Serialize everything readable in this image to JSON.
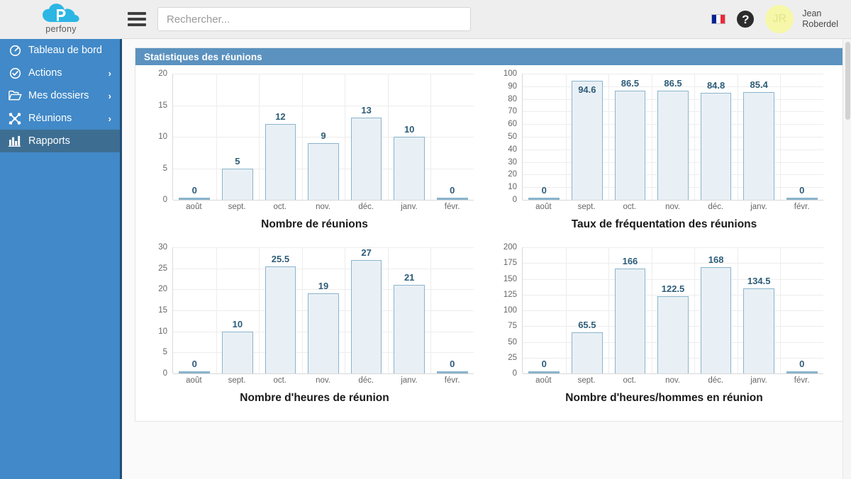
{
  "app": {
    "logo_text": "perfony",
    "logo_accent": "#2cb6e4"
  },
  "header": {
    "menu_icon": "hamburger-icon",
    "search": {
      "value": "",
      "placeholder": "Rechercher..."
    },
    "language_icon": "french-flag-icon",
    "help_icon": "help-question-icon",
    "user": {
      "initials": "JR",
      "first_name": "Jean",
      "last_name": "Roberdel"
    }
  },
  "sidebar": {
    "background": "#4189c8",
    "active_background": "#3d6e92",
    "items": [
      {
        "label": "Tableau de bord",
        "icon": "gauge-icon",
        "has_chevron": false,
        "active": false
      },
      {
        "label": "Actions",
        "icon": "check-circle-icon",
        "has_chevron": true,
        "active": false
      },
      {
        "label": "Mes dossiers",
        "icon": "folder-open-icon",
        "has_chevron": true,
        "active": false
      },
      {
        "label": "Réunions",
        "icon": "network-nodes-icon",
        "has_chevron": true,
        "active": false
      },
      {
        "label": "Rapports",
        "icon": "bar-chart-icon",
        "has_chevron": false,
        "active": true
      }
    ],
    "chevron_glyph": "›"
  },
  "panel": {
    "title": "Statistiques des réunions",
    "header_color": "#5b92bf"
  },
  "chart_data": [
    {
      "type": "bar",
      "title": "Nombre de réunions",
      "xlabel": "",
      "ylabel": "",
      "categories": [
        "août",
        "sept.",
        "oct.",
        "nov.",
        "déc.",
        "janv.",
        "févr."
      ],
      "values": [
        0,
        5,
        12,
        9,
        13,
        10,
        0
      ],
      "labels": [
        "0",
        "5",
        "12",
        "9",
        "13",
        "10",
        "0"
      ],
      "yticks": [
        0,
        5,
        10,
        15,
        20
      ],
      "ylim": [
        0,
        20
      ],
      "grid": true,
      "legend": "none",
      "bar_fill": "#e9f0f5",
      "bar_stroke": "#8ab4cd",
      "label_color": "#2e5c78"
    },
    {
      "type": "bar",
      "title": "Taux de fréquentation des réunions",
      "xlabel": "",
      "ylabel": "",
      "categories": [
        "août",
        "sept.",
        "oct.",
        "nov.",
        "déc.",
        "janv.",
        "févr."
      ],
      "values": [
        0,
        94.6,
        86.5,
        86.5,
        84.8,
        85.4,
        0
      ],
      "labels": [
        "0",
        "94.6",
        "86.5",
        "86.5",
        "84.8",
        "85.4",
        "0"
      ],
      "label_inside": [
        false,
        true,
        false,
        false,
        false,
        false,
        false
      ],
      "yticks": [
        0,
        10,
        20,
        30,
        40,
        50,
        60,
        70,
        80,
        90,
        100
      ],
      "ylim": [
        0,
        100
      ],
      "grid": true,
      "legend": "none",
      "bar_fill": "#e9f0f5",
      "bar_stroke": "#8ab4cd",
      "label_color": "#2e5c78"
    },
    {
      "type": "bar",
      "title": "Nombre d'heures de réunion",
      "xlabel": "",
      "ylabel": "",
      "categories": [
        "août",
        "sept.",
        "oct.",
        "nov.",
        "déc.",
        "janv.",
        "févr."
      ],
      "values": [
        0,
        10,
        25.5,
        19,
        27,
        21,
        0
      ],
      "labels": [
        "0",
        "10",
        "25.5",
        "19",
        "27",
        "21",
        "0"
      ],
      "yticks": [
        0,
        5,
        10,
        15,
        20,
        25,
        30
      ],
      "ylim": [
        0,
        30
      ],
      "grid": true,
      "legend": "none",
      "bar_fill": "#e9f0f5",
      "bar_stroke": "#8ab4cd",
      "label_color": "#2e5c78"
    },
    {
      "type": "bar",
      "title": "Nombre d'heures/hommes en réunion",
      "xlabel": "",
      "ylabel": "",
      "categories": [
        "août",
        "sept.",
        "oct.",
        "nov.",
        "déc.",
        "janv.",
        "févr."
      ],
      "values": [
        0,
        65.5,
        166,
        122.5,
        168,
        134.5,
        0
      ],
      "labels": [
        "0",
        "65.5",
        "166",
        "122.5",
        "168",
        "134.5",
        "0"
      ],
      "yticks": [
        0,
        25,
        50,
        75,
        100,
        125,
        150,
        175,
        200
      ],
      "ylim": [
        0,
        200
      ],
      "grid": true,
      "legend": "none",
      "bar_fill": "#e9f0f5",
      "bar_stroke": "#8ab4cd",
      "label_color": "#2e5c78"
    }
  ]
}
